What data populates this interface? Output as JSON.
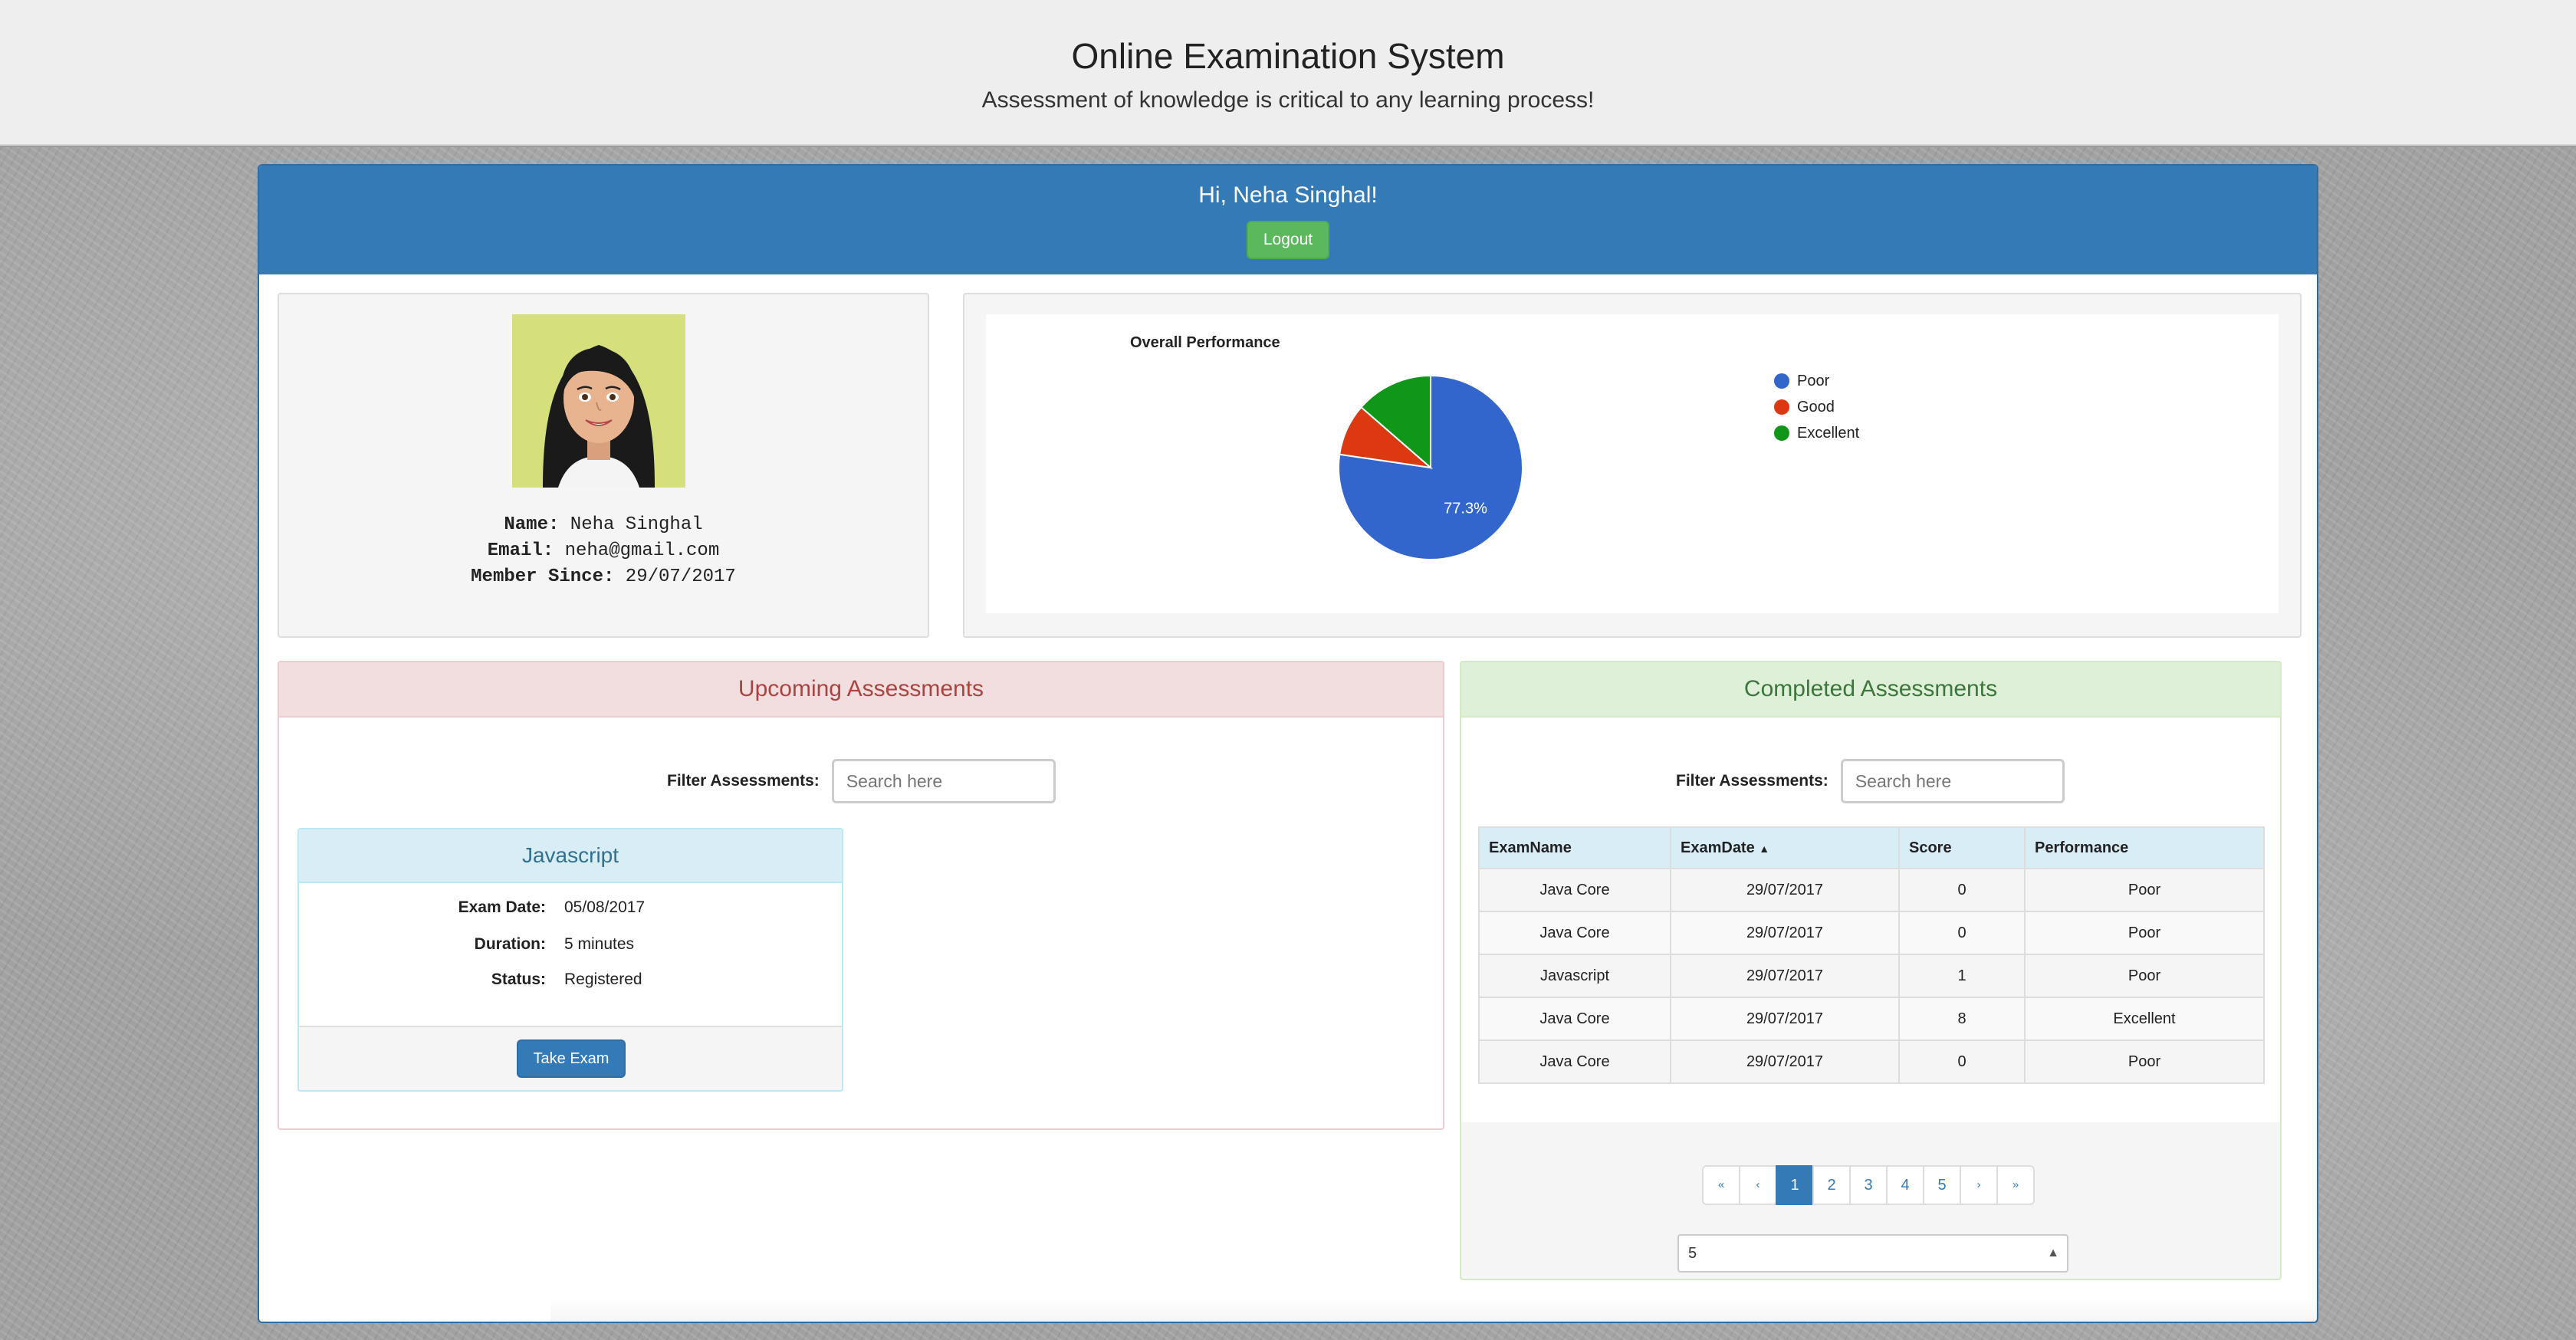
{
  "header": {
    "title": "Online Examination System",
    "subtitle": "Assessment of knowledge is critical to any learning process!"
  },
  "user": {
    "greeting": "Hi, Neha Singhal!",
    "logout_label": "Logout",
    "name_label": "Name:",
    "name": "Neha Singhal",
    "email_label": "Email:",
    "email": "neha@gmail.com",
    "member_label": "Member Since:",
    "member_since": "29/07/2017"
  },
  "performance": {
    "title": "Overall Performance",
    "legend": [
      {
        "label": "Poor",
        "color": "#3366cc"
      },
      {
        "label": "Good",
        "color": "#dc3912"
      },
      {
        "label": "Excellent",
        "color": "#109618"
      }
    ]
  },
  "chart_data": {
    "type": "pie",
    "title": "Overall Performance",
    "categories": [
      "Poor",
      "Good",
      "Excellent"
    ],
    "values": [
      77.3,
      9.1,
      13.6
    ],
    "slice_labels": [
      "77.3%",
      "",
      ""
    ],
    "legend": "right"
  },
  "upcoming": {
    "heading": "Upcoming Assessments",
    "filter_label": "Filter Assessments:",
    "filter_placeholder": "Search here",
    "exam": {
      "name": "Javascript",
      "date_label": "Exam Date:",
      "date": "05/08/2017",
      "duration_label": "Duration:",
      "duration": "5 minutes",
      "status_label": "Status:",
      "status": "Registered",
      "action_label": "Take Exam"
    }
  },
  "completed": {
    "heading": "Completed Assessments",
    "filter_label": "Filter Assessments:",
    "filter_placeholder": "Search here",
    "columns": [
      "ExamName",
      "ExamDate",
      "Score",
      "Performance"
    ],
    "rows": [
      [
        "Java Core",
        "29/07/2017",
        "0",
        "Poor"
      ],
      [
        "Java Core",
        "29/07/2017",
        "0",
        "Poor"
      ],
      [
        "Javascript",
        "29/07/2017",
        "1",
        "Poor"
      ],
      [
        "Java Core",
        "29/07/2017",
        "8",
        "Excellent"
      ],
      [
        "Java Core",
        "29/07/2017",
        "0",
        "Poor"
      ]
    ],
    "pagination": [
      "«",
      "‹",
      "1",
      "2",
      "3",
      "4",
      "5",
      "›",
      "»"
    ],
    "current_page": "1",
    "page_size": "5"
  }
}
